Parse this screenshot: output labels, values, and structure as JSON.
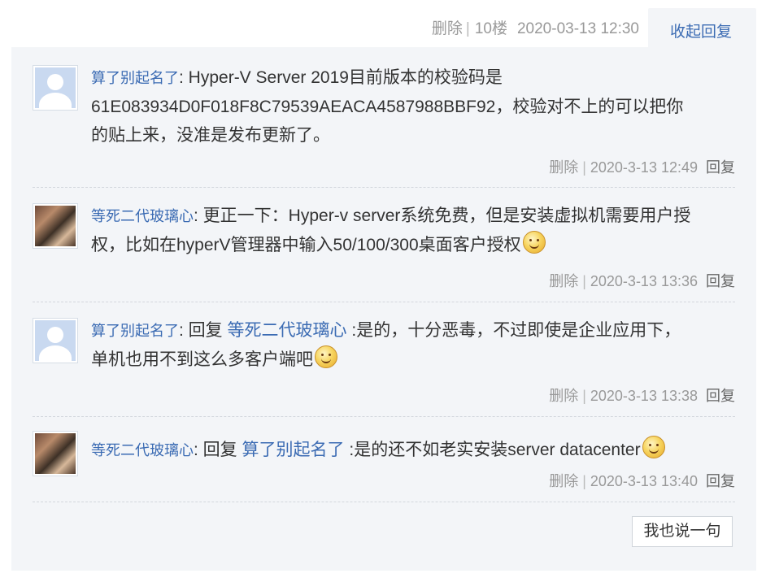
{
  "header": {
    "delete_label": "删除",
    "separator": "|",
    "floor": "10楼",
    "datetime": "2020-03-13 12:30",
    "collapse_label": "收起回复"
  },
  "replies": [
    {
      "author": "算了别起名了",
      "avatar": "default-avatar",
      "segments": [
        "Hyper-V Server 2019目前版本的校验码是",
        "61E083934D0F018F8C79539AEACA4587988BBF92，校验对不上的可以把你",
        "的贴上来，没准是发布更新了。"
      ],
      "delete_label": "删除",
      "time": "2020-3-13 12:49",
      "reply_label": "回复"
    },
    {
      "author": "等死二代玻璃心",
      "avatar": "photo-avatar",
      "segments": [
        "更正一下：Hyper-v server系统免费，但是安装虚拟机需要用户授",
        "权，比如在hyperV管理器中输入50/100/300桌面客户授权"
      ],
      "emoji": "smiley-icon",
      "delete_label": "删除",
      "time": "2020-3-13 13:36",
      "reply_label": "回复"
    },
    {
      "author": "算了别起名了",
      "avatar": "default-avatar",
      "reply_prefix": "回复",
      "reply_to": "等死二代玻璃心",
      "segments": [
        ":是的，十分恶毒，不过即使是企业应用下，",
        "单机也用不到这么多客户端吧"
      ],
      "emoji": "smiley-icon",
      "delete_label": "删除",
      "time": "2020-3-13 13:38",
      "reply_label": "回复"
    },
    {
      "author": "等死二代玻璃心",
      "avatar": "photo-avatar",
      "reply_prefix": "回复",
      "reply_to": "算了别起名了",
      "segments": [
        ":是的还不如老实安装server datacenter"
      ],
      "emoji": "smiley-icon",
      "delete_label": "删除",
      "time": "2020-3-13 13:40",
      "reply_label": "回复"
    }
  ],
  "footer": {
    "say_button": "我也说一句"
  },
  "colors": {
    "link": "#3b6bb3",
    "panel_bg": "#f3f5f8",
    "meta_text": "#999999"
  }
}
